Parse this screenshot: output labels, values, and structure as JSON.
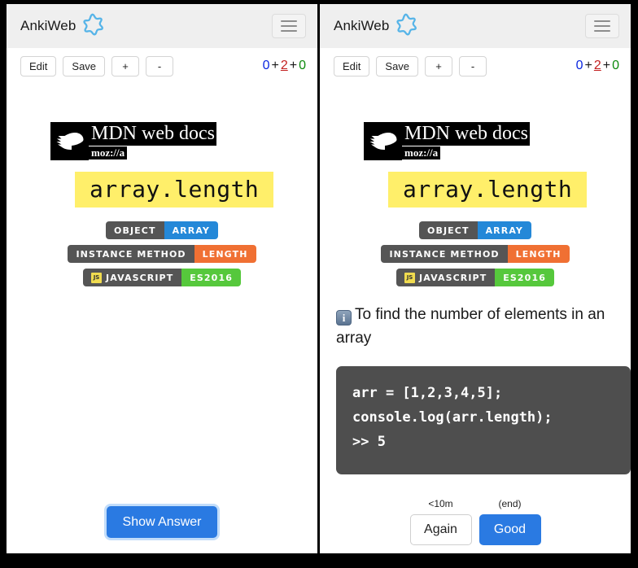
{
  "header": {
    "brand": "AnkiWeb",
    "star_color": "#56b4e8",
    "menu_icon": "hamburger-menu-icon"
  },
  "toolbar": {
    "buttons": [
      {
        "label": "Edit",
        "name": "edit-button"
      },
      {
        "label": "Save",
        "name": "save-button"
      },
      {
        "label": "+",
        "name": "increase-button"
      },
      {
        "label": "-",
        "name": "decrease-button"
      }
    ],
    "counter": {
      "new": "0",
      "learning": "2",
      "due": "0",
      "separator": "+",
      "new_color": "#0a26e0",
      "learning_color": "#c32020",
      "due_color": "#0c8a0c"
    }
  },
  "card": {
    "mdn": {
      "title": "MDN web docs",
      "subtitle": "moz://a"
    },
    "term": "array.length",
    "term_bg": "#ffef6a",
    "badges": [
      {
        "left": "OBJECT",
        "right": "ARRAY",
        "right_color": "#2488d8",
        "left_color": "#555555",
        "icon": null
      },
      {
        "left": "INSTANCE METHOD",
        "right": "LENGTH",
        "right_color": "#f07033",
        "left_color": "#555555",
        "icon": null
      },
      {
        "left": "JAVASCRIPT",
        "right": "ES2016",
        "right_color": "#56c83c",
        "left_color": "#555555",
        "icon": "JS"
      }
    ],
    "answer_note": "To find the number of elements in an array",
    "answer_note_emoji": "information-emoji",
    "code": "arr = [1,2,3,4,5];\nconsole.log(arr.length);\n>> 5"
  },
  "front_footer": {
    "show_answer": "Show Answer"
  },
  "back_footer": {
    "buttons": [
      {
        "interval": "<10m",
        "label": "Again",
        "name": "again-button",
        "primary": false
      },
      {
        "interval": "(end)",
        "label": "Good",
        "name": "good-button",
        "primary": true
      }
    ]
  }
}
